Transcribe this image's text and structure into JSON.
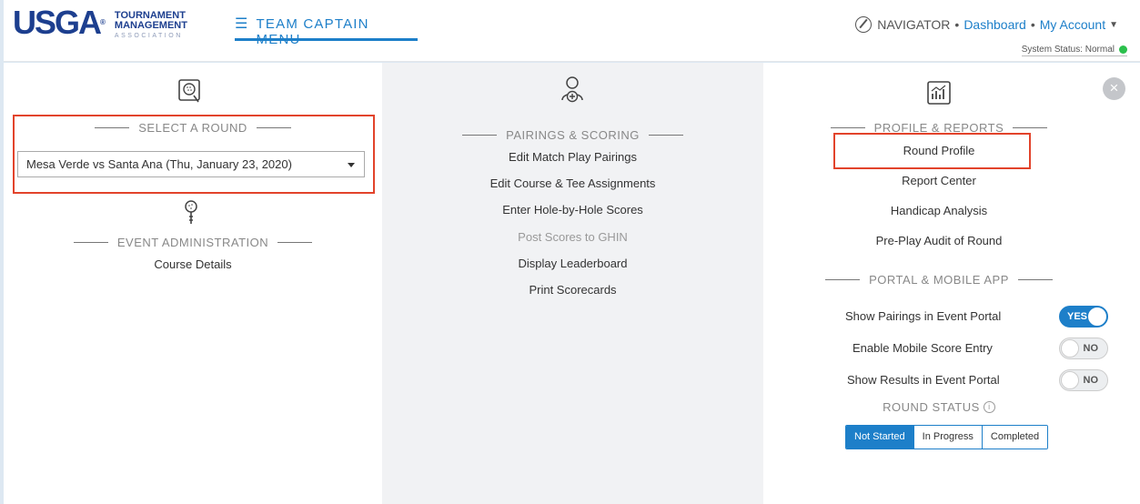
{
  "header": {
    "logo_main": "USGA",
    "logo_line1": "TOURNAMENT",
    "logo_line2": "MANAGEMENT",
    "logo_line3": "ASSOCIATION",
    "menu_label": "TEAM CAPTAIN MENU",
    "navigator_label": "NAVIGATOR",
    "dashboard_link": "Dashboard",
    "account_link": "My Account",
    "system_status": "System Status: Normal"
  },
  "left": {
    "select_round_title": "SELECT A ROUND",
    "selected_round": "Mesa Verde vs Santa Ana (Thu, January 23, 2020)",
    "event_admin_title": "EVENT ADMINISTRATION",
    "course_details": "Course Details"
  },
  "middle": {
    "title": "PAIRINGS & SCORING",
    "items": [
      "Edit Match Play Pairings",
      "Edit Course & Tee Assignments",
      "Enter Hole-by-Hole Scores",
      "Post Scores to GHIN",
      "Display Leaderboard",
      "Print Scorecards"
    ]
  },
  "right": {
    "profile_title": "PROFILE & REPORTS",
    "profile_items": [
      "Round Profile",
      "Report Center",
      "Handicap Analysis",
      "Pre-Play Audit of Round"
    ],
    "portal_title": "PORTAL & MOBILE APP",
    "toggles": [
      {
        "label": "Show Pairings in Event Portal",
        "value": "YES"
      },
      {
        "label": "Enable Mobile Score Entry",
        "value": "NO"
      },
      {
        "label": "Show Results in Event Portal",
        "value": "NO"
      }
    ],
    "round_status_title": "ROUND STATUS",
    "status_options": [
      "Not Started",
      "In Progress",
      "Completed"
    ],
    "status_selected": "Not Started"
  },
  "colors": {
    "accent": "#1d7fc9",
    "brand": "#1d3f8f",
    "highlight": "#e2432b",
    "status_ok": "#2bc04c"
  }
}
